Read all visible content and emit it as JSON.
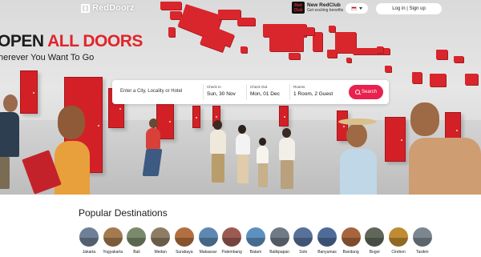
{
  "header": {
    "logo_text": "RedDoorz",
    "redclub": {
      "badge": "Red Club",
      "title": "New RedClub",
      "subtitle": "Get exciting benefits"
    },
    "language_flag": "flag-indonesia-icon",
    "login_label": "Log in | Sign up"
  },
  "hero": {
    "headline_start": "OPEN ",
    "headline_accent": "ALL DOORS",
    "subline": "herever You Want To Go",
    "accent_color": "#e1242b"
  },
  "search": {
    "location_placeholder": "Enter a City, Locality or Hotel",
    "check_in": {
      "label": "Check In",
      "value": "Sun, 30 Nov"
    },
    "check_out": {
      "label": "Check Out",
      "value": "Mon, 01 Dec"
    },
    "rooms": {
      "label": "Rooms",
      "value": "1 Room, 2 Guest"
    },
    "button_label": "Search",
    "button_color": "#e8214f"
  },
  "popular": {
    "title": "Popular Destinations",
    "items": [
      {
        "name": "Jakarta",
        "color": "#6f7f95"
      },
      {
        "name": "Yogyakarta",
        "color": "#a47a4f"
      },
      {
        "name": "Bali",
        "color": "#7b8a6a"
      },
      {
        "name": "Medan",
        "color": "#8d7d63"
      },
      {
        "name": "Surabaya",
        "color": "#b36f3f"
      },
      {
        "name": "Makassar",
        "color": "#5d88b1"
      },
      {
        "name": "Palembang",
        "color": "#9d5a52"
      },
      {
        "name": "Batam",
        "color": "#5c91bf"
      },
      {
        "name": "Balikpapan",
        "color": "#6e7a86"
      },
      {
        "name": "Solo",
        "color": "#57719b"
      },
      {
        "name": "Banyumas",
        "color": "#4f6c99"
      },
      {
        "name": "Bandung",
        "color": "#a8643c"
      },
      {
        "name": "Bogor",
        "color": "#5e6758"
      },
      {
        "name": "Cirebon",
        "color": "#c08b32"
      },
      {
        "name": "Tasikm",
        "color": "#7b8790"
      }
    ]
  }
}
